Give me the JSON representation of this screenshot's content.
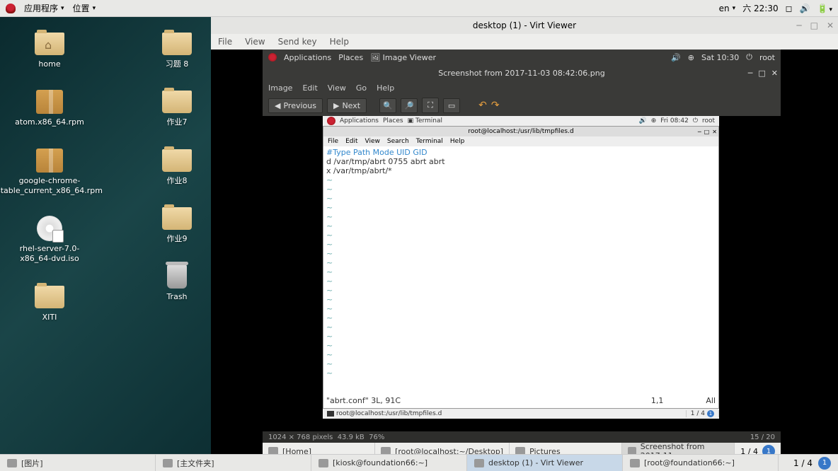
{
  "top_panel": {
    "apps": "应用程序",
    "places": "位置",
    "lang": "en",
    "day_time": "六 22:30"
  },
  "desktop_icons_col1": [
    {
      "type": "folder-home",
      "label": "home"
    },
    {
      "type": "package",
      "label": "atom.x86_64.rpm"
    },
    {
      "type": "package",
      "label": "google-chrome-stable_current_x86_64.rpm"
    },
    {
      "type": "disc",
      "label": "rhel-server-7.0-x86_64-dvd.iso"
    },
    {
      "type": "folder",
      "label": "XITI"
    }
  ],
  "desktop_icons_col2": [
    {
      "type": "folder",
      "label": "习题 8"
    },
    {
      "type": "folder",
      "label": "作业7"
    },
    {
      "type": "folder",
      "label": "作业8"
    },
    {
      "type": "folder",
      "label": "作业9"
    },
    {
      "type": "trash",
      "label": "Trash"
    }
  ],
  "virt": {
    "title": "desktop (1) - Virt Viewer",
    "menu": [
      "File",
      "View",
      "Send key",
      "Help"
    ]
  },
  "inner_panel": {
    "apps": "Applications",
    "places": "Places",
    "imgviewer": "Image Viewer",
    "time": "Sat 10:30",
    "user": "root"
  },
  "imgv": {
    "title": "Screenshot from 2017-11-03 08:42:06.png",
    "menu": [
      "Image",
      "Edit",
      "View",
      "Go",
      "Help"
    ],
    "prev": "Previous",
    "next": "Next",
    "status_dims": "1024 × 768 pixels",
    "status_size": "43.9 kB",
    "status_zoom": "76%",
    "status_page": "15 / 20",
    "taskbar": [
      {
        "label": "[Home]"
      },
      {
        "label": "[root@localhost:~/Desktop]"
      },
      {
        "label": "Pictures"
      },
      {
        "label": "Screenshot from 2017-11...",
        "active": true
      }
    ],
    "tb_right": "1 / 4"
  },
  "nested": {
    "panel_apps": "Applications",
    "panel_places": "Places",
    "panel_term": "Terminal",
    "panel_time": "Fri 08:42",
    "panel_user": "root",
    "term_title": "root@localhost:/usr/lib/tmpfiles.d",
    "term_menu": [
      "File",
      "Edit",
      "View",
      "Search",
      "Terminal",
      "Help"
    ],
    "header": "#Type Path           Mode UID  GID",
    "line1": "d     /var/tmp/abrt 0755 abrt abrt",
    "line2": "x     /var/tmp/abrt/*",
    "status_left": "\"abrt.conf\" 3L, 91C",
    "status_pos": "1,1",
    "status_right": "All",
    "tb_item": "root@localhost:/usr/lib/tmpfiles.d",
    "tb_right": "1 / 4"
  },
  "host_taskbar": [
    {
      "label": "[图片]"
    },
    {
      "label": "[主文件夹]"
    },
    {
      "label": "[kiosk@foundation66:~]"
    },
    {
      "label": "desktop (1) - Virt Viewer",
      "active": true
    },
    {
      "label": "[root@foundation66:~]"
    }
  ],
  "host_tb_right": "1 / 4"
}
